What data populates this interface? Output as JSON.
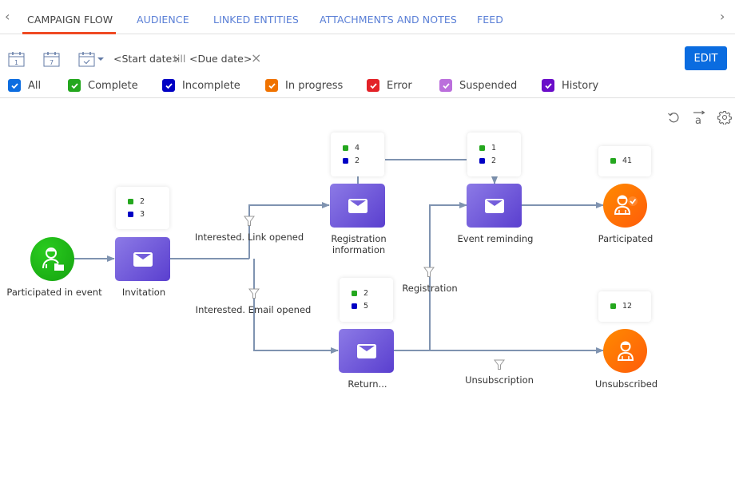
{
  "tabs": {
    "prev_icon": "chevron-left-icon",
    "next_icon": "chevron-right-icon",
    "items": [
      {
        "label": "CAMPAIGN FLOW",
        "active": true
      },
      {
        "label": "AUDIENCE",
        "active": false
      },
      {
        "label": "LINKED ENTITIES",
        "active": false
      },
      {
        "label": "ATTACHMENTS AND NOTES",
        "active": false
      },
      {
        "label": "FEED",
        "active": false
      }
    ],
    "accent_color": "#ef4a23"
  },
  "toolbar": {
    "calendar_day_label": "1",
    "calendar_week_label": "7",
    "start_date": "<Start date>",
    "till": "till",
    "due_date": "<Due date>",
    "clear_label": "×",
    "edit_label": "EDIT",
    "edit_color": "#0a6ce0"
  },
  "filters": [
    {
      "label": "All",
      "color": "#0d6de0",
      "checked": true
    },
    {
      "label": "Complete",
      "color": "#24a71e",
      "checked": true
    },
    {
      "label": "Incomplete",
      "color": "#0000c4",
      "checked": true
    },
    {
      "label": "In progress",
      "color": "#f07300",
      "checked": true
    },
    {
      "label": "Error",
      "color": "#e32228",
      "checked": true
    },
    {
      "label": "Suspended",
      "color": "#bb6fdc",
      "checked": true
    },
    {
      "label": "History",
      "color": "#6a0cc9",
      "checked": true
    }
  ],
  "canvas_tools": [
    "undo-icon",
    "auto-layout-icon",
    "settings-icon"
  ],
  "diagram": {
    "nodes": [
      {
        "id": "participated-in-event",
        "label": "Participated in event",
        "type": "audience-start"
      },
      {
        "id": "invitation",
        "label": "Invitation",
        "type": "email",
        "stats": {
          "complete": "2",
          "incomplete": "3"
        }
      },
      {
        "id": "registration-information",
        "label": "Registration information",
        "type": "email",
        "stats": {
          "complete": "4",
          "incomplete": "2"
        }
      },
      {
        "id": "return",
        "label": "Return...",
        "type": "email",
        "stats": {
          "complete": "2",
          "incomplete": "5"
        }
      },
      {
        "id": "event-reminding",
        "label": "Event reminding",
        "type": "email",
        "stats": {
          "complete": "1",
          "incomplete": "2"
        }
      },
      {
        "id": "participated",
        "label": "Participated",
        "type": "audience-exit-checked",
        "stats": {
          "complete": "41"
        }
      },
      {
        "id": "unsubscribed",
        "label": "Unsubscribed",
        "type": "audience-exit",
        "stats": {
          "complete": "12"
        }
      }
    ],
    "edges": [
      {
        "label": "Interested. Link opened"
      },
      {
        "label": "Interested. Email opened"
      },
      {
        "label": "Registration"
      },
      {
        "label": "Unsubscription"
      }
    ],
    "stat_colors": {
      "complete": "#24a71e",
      "incomplete": "#0000c4"
    }
  }
}
